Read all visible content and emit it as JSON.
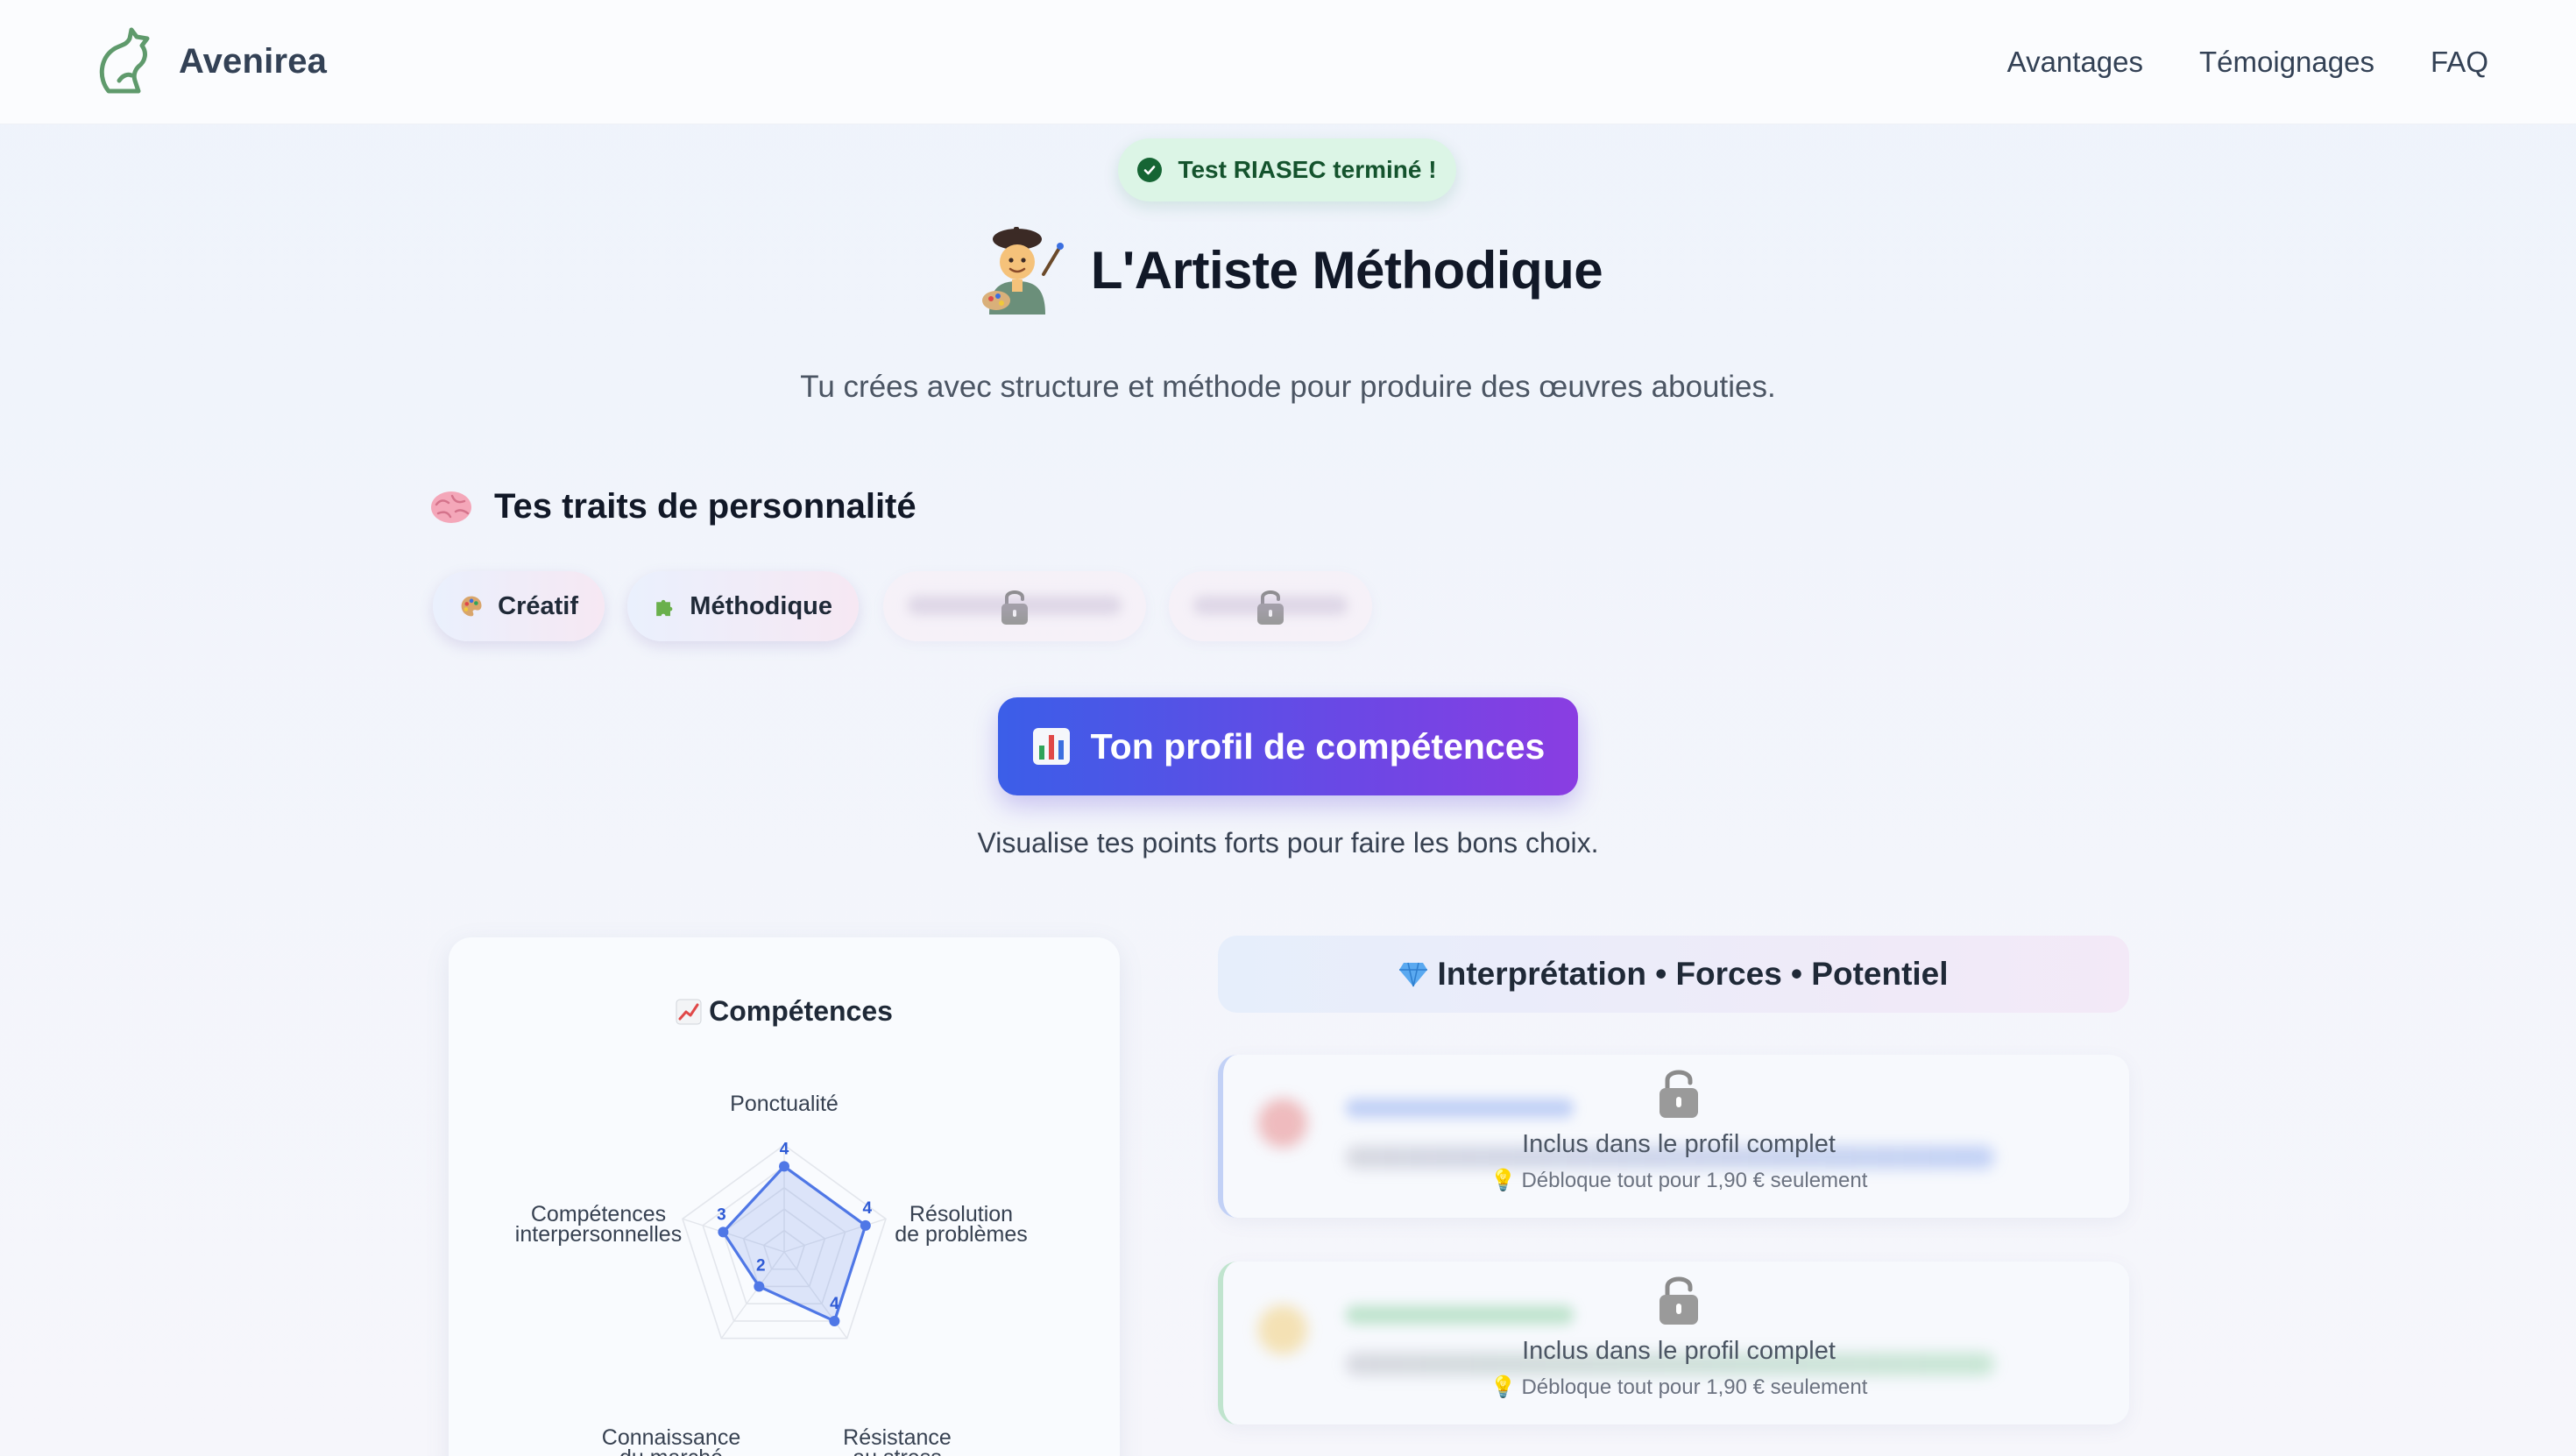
{
  "header": {
    "brand_name": "Avenirea",
    "nav": [
      "Avantages",
      "Témoignages",
      "FAQ"
    ]
  },
  "badge": {
    "label": "Test RIASEC terminé !",
    "icon": "check-circle-icon"
  },
  "profile": {
    "title": "L'Artiste Méthodique",
    "emoji": "artist-emoji",
    "description": "Tu crées avec structure et méthode pour produire des œuvres abouties."
  },
  "traits": {
    "title": "Tes traits de personnalité",
    "icon": "brain-icon",
    "chips": [
      {
        "label": "Créatif",
        "icon": "palette-icon",
        "locked": false
      },
      {
        "label": "Méthodique",
        "icon": "puzzle-icon",
        "locked": false
      },
      {
        "locked": true
      },
      {
        "locked": true
      }
    ]
  },
  "cta": {
    "label": "Ton profil de compétences",
    "icon": "bar-chart-icon",
    "subtitle": "Visualise tes points forts pour faire les bons choix."
  },
  "skills_card": {
    "title": "Compétences",
    "icon": "chart-increasing-icon"
  },
  "chart_data": {
    "type": "radar",
    "title": "Compétences",
    "axes": [
      "Ponctualité",
      "Résolution de problèmes",
      "Résistance au stress",
      "Connaissance du marché",
      "Compétences interpersonnelles"
    ],
    "axis_labels_lines": [
      [
        "Ponctualité"
      ],
      [
        "Résolution",
        "de problèmes"
      ],
      [
        "Résistance",
        "au stress"
      ],
      [
        "Connaissance",
        "du marché"
      ],
      [
        "Compétences",
        "interpersonnelles"
      ]
    ],
    "values": [
      4,
      4,
      4,
      2,
      3
    ],
    "rmax": 5,
    "color": "#4f77e6"
  },
  "interpretation": {
    "header": "Interprétation • Forces • Potentiel",
    "icon": "gem-icon",
    "locked_cards": [
      {
        "text": "Inclus dans le profil complet",
        "sub": "Débloque tout pour 1,90 € seulement",
        "accent": "#5f87eb"
      },
      {
        "text": "Inclus dans le profil complet",
        "sub": "Débloque tout pour 1,90 € seulement",
        "accent": "#5abe78"
      }
    ]
  }
}
